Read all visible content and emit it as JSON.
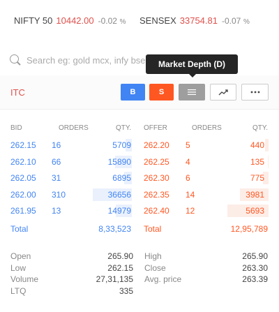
{
  "indices": [
    {
      "name": "NIFTY 50",
      "value": "10442.00",
      "change": "-0.02",
      "pct": "%"
    },
    {
      "name": "SENSEX",
      "value": "33754.81",
      "change": "-0.07",
      "pct": "%"
    }
  ],
  "search": {
    "placeholder": "Search eg: gold mcx, infy bse"
  },
  "tooltip": "Market Depth (D)",
  "stock": {
    "symbol": "ITC",
    "buy_label": "B",
    "sell_label": "S",
    "icons": {
      "depth": "list-icon",
      "chart": "trend-chart-icon",
      "more": "more-dots-icon"
    }
  },
  "depth": {
    "headers": {
      "bid": "BID",
      "orders": "ORDERS",
      "qty": "QTY.",
      "offer": "OFFER",
      "offer_orders": "ORDERS",
      "offer_qty": "QTY."
    },
    "bids": [
      {
        "price": "262.15",
        "orders": "16",
        "qty": "5709",
        "fill": 0.156
      },
      {
        "price": "262.10",
        "orders": "66",
        "qty": "15890",
        "fill": 0.433
      },
      {
        "price": "262.05",
        "orders": "31",
        "qty": "6895",
        "fill": 0.188
      },
      {
        "price": "262.00",
        "orders": "310",
        "qty": "36656",
        "fill": 1.0
      },
      {
        "price": "261.95",
        "orders": "13",
        "qty": "14979",
        "fill": 0.409
      }
    ],
    "offers": [
      {
        "price": "262.20",
        "orders": "5",
        "qty": "440",
        "fill": 0.077
      },
      {
        "price": "262.25",
        "orders": "4",
        "qty": "135",
        "fill": 0.024
      },
      {
        "price": "262.30",
        "orders": "6",
        "qty": "775",
        "fill": 0.136
      },
      {
        "price": "262.35",
        "orders": "14",
        "qty": "3981",
        "fill": 0.699
      },
      {
        "price": "262.40",
        "orders": "12",
        "qty": "5693",
        "fill": 1.0
      }
    ],
    "total_label": "Total",
    "bid_total": "8,33,523",
    "offer_total": "12,95,789"
  },
  "stats": {
    "left": [
      {
        "label": "Open",
        "value": "265.90"
      },
      {
        "label": "Low",
        "value": "262.15"
      },
      {
        "label": "Volume",
        "value": "27,31,135"
      },
      {
        "label": "LTQ",
        "value": "335"
      }
    ],
    "right": [
      {
        "label": "High",
        "value": "265.90"
      },
      {
        "label": "Close",
        "value": "263.30"
      },
      {
        "label": "Avg. price",
        "value": "263.39"
      }
    ]
  }
}
